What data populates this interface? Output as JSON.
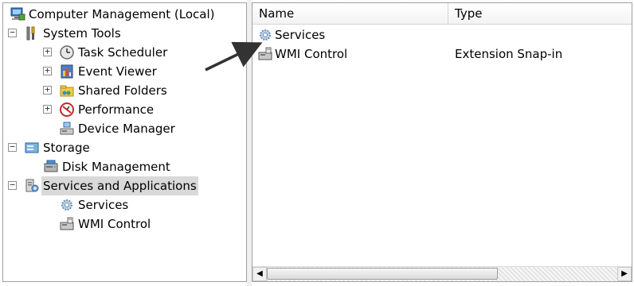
{
  "tree": {
    "items": [
      {
        "label": "Computer Management (Local)",
        "icon": "computer-management-icon",
        "expander": ""
      },
      {
        "label": "System Tools",
        "icon": "tools-icon",
        "expander": "−"
      },
      {
        "label": "Task Scheduler",
        "icon": "clock-icon",
        "expander": "+"
      },
      {
        "label": "Event Viewer",
        "icon": "event-viewer-icon",
        "expander": "+"
      },
      {
        "label": "Shared Folders",
        "icon": "shared-folder-icon",
        "expander": "+"
      },
      {
        "label": "Performance",
        "icon": "performance-icon",
        "expander": "+"
      },
      {
        "label": "Device Manager",
        "icon": "device-manager-icon",
        "expander": ""
      },
      {
        "label": "Storage",
        "icon": "storage-icon",
        "expander": "−"
      },
      {
        "label": "Disk Management",
        "icon": "disk-icon",
        "expander": ""
      },
      {
        "label": "Services and Applications",
        "icon": "services-apps-icon",
        "expander": "−"
      },
      {
        "label": "Services",
        "icon": "gear-icon",
        "expander": ""
      },
      {
        "label": "WMI Control",
        "icon": "wmi-icon",
        "expander": ""
      }
    ]
  },
  "list": {
    "columns": [
      "Name",
      "Type"
    ],
    "rows": [
      {
        "name": "Services",
        "type": "",
        "icon": "gear-icon"
      },
      {
        "name": "WMI Control",
        "type": "Extension Snap-in",
        "icon": "wmi-icon"
      }
    ]
  },
  "scrollbar": {
    "left_arrow": "◀",
    "right_arrow": "▶"
  },
  "colors": {
    "selection": "#d9d9d9",
    "border": "#a0a0a0",
    "annotation_arrow": "#333333"
  }
}
